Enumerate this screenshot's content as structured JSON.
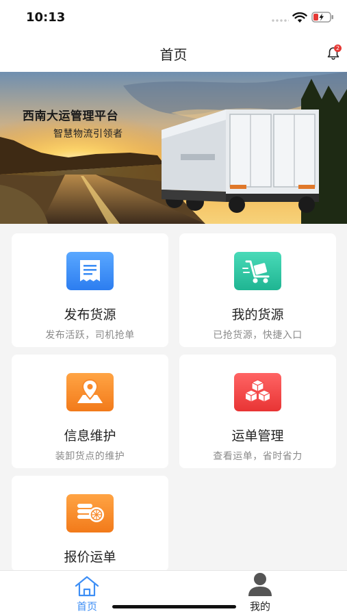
{
  "status_bar": {
    "time": "10:13"
  },
  "nav": {
    "title": "首页",
    "notification_count": "2"
  },
  "banner": {
    "title": "西南大运管理平台",
    "subtitle": "智慧物流引领者"
  },
  "cards": [
    {
      "title": "发布货源",
      "subtitle": "发布活跃，司机抢单",
      "icon": "document-icon",
      "color": "#3d8ef5"
    },
    {
      "title": "我的货源",
      "subtitle": "已抢货源，快捷入口",
      "icon": "hand-truck-icon",
      "color": "#2ec7a5"
    },
    {
      "title": "信息维护",
      "subtitle": "装卸货点的维护",
      "icon": "map-pin-icon",
      "color": "#f88a2c"
    },
    {
      "title": "运单管理",
      "subtitle": "查看运单，省时省力",
      "icon": "cubes-icon",
      "color": "#f54c4c"
    },
    {
      "title": "报价运单",
      "subtitle": "",
      "icon": "coins-icon",
      "color": "#f88a2c"
    }
  ],
  "tabbar": {
    "tabs": [
      {
        "label": "首页",
        "icon": "home-icon",
        "active": true
      },
      {
        "label": "我的",
        "icon": "user-icon",
        "active": false
      }
    ],
    "active_color": "#3d8ef5"
  }
}
